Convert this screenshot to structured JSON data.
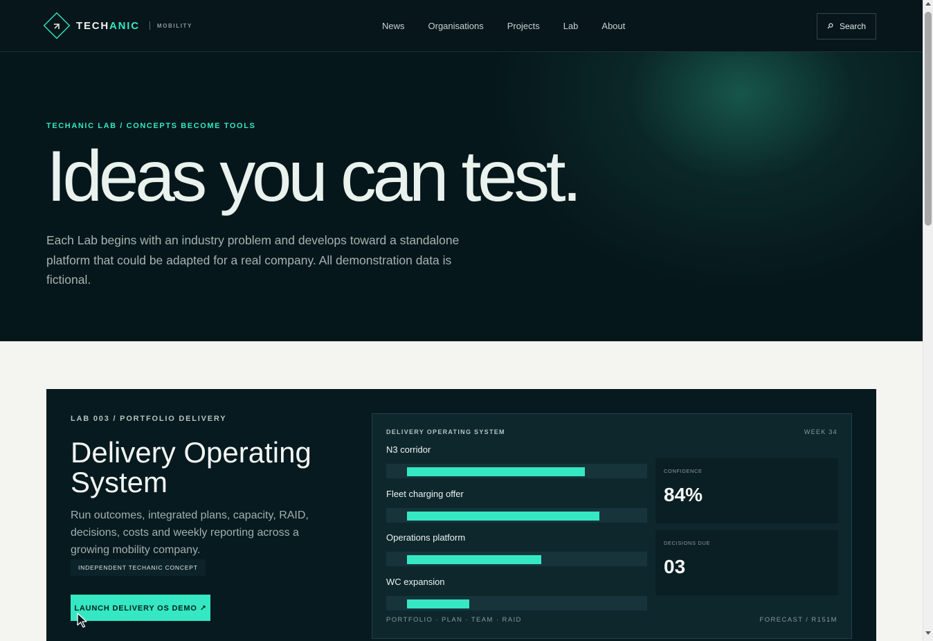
{
  "header": {
    "logo": {
      "word_a": "TECH",
      "word_b": "ANIC",
      "sub": "MOBILITY"
    },
    "nav": [
      {
        "label": "News"
      },
      {
        "label": "Organisations"
      },
      {
        "label": "Projects"
      },
      {
        "label": "Lab"
      },
      {
        "label": "About"
      }
    ],
    "search": {
      "label": "Search",
      "icon": "search-icon"
    }
  },
  "hero": {
    "kicker": "TECHANIC LAB / CONCEPTS BECOME TOOLS",
    "title": "Ideas you can test.",
    "description": "Each Lab begins with an industry problem and develops toward a standalone platform that could be adapted for a real company. All demonstration data is fictional."
  },
  "lab": {
    "kicker": "LAB 003 / PORTFOLIO DELIVERY",
    "title": "Delivery Operating System",
    "description": "Run outcomes, integrated plans, capacity, RAID, decisions, costs and weekly reporting across a growing mobility company.",
    "badge": "INDEPENDENT TECHANIC CONCEPT",
    "cta": "LAUNCH DELIVERY OS DEMO ↗",
    "dashboard": {
      "title": "DELIVERY OPERATING SYSTEM",
      "week": "WEEK 34",
      "projects": [
        {
          "name": "N3 corridor",
          "progress": 0.74
        },
        {
          "name": "Fleet charging offer",
          "progress": 0.8
        },
        {
          "name": "Operations platform",
          "progress": 0.56
        },
        {
          "name": "WC expansion",
          "progress": 0.26
        }
      ],
      "stats": [
        {
          "label": "CONFIDENCE",
          "value": "84%"
        },
        {
          "label": "DECISIONS DUE",
          "value": "03"
        }
      ],
      "footer_left": "PORTFOLIO · PLAN · TEAM · RAID",
      "footer_right": "FORECAST / R151M"
    }
  },
  "colors": {
    "accent": "#35e8c3",
    "dark": "#06161a",
    "light_bg": "#f4f5f0"
  }
}
